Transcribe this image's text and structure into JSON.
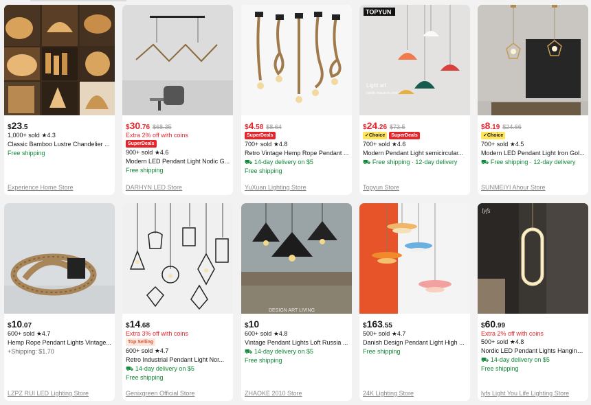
{
  "products": [
    {
      "currency": "$",
      "price_int": "23",
      "price_dec": ".5",
      "orig": "",
      "red": false,
      "extra": "",
      "badges": [],
      "sold": "1,000+ sold",
      "rating": "4.3",
      "title": "Classic Bamboo Lustre Chandelier ...",
      "ship1": "Free shipping",
      "ship2": "",
      "store": "Experience Home Store"
    },
    {
      "currency": "$",
      "price_int": "30",
      "price_dec": ".76",
      "orig": "$68.35",
      "red": true,
      "extra": "Extra 2% off with coins",
      "badges": [
        "SuperDeals"
      ],
      "sold": "900+ sold",
      "rating": "4.6",
      "title": "Modern LED Pendant Light Nodic G...",
      "ship1": "Free shipping",
      "ship2": "",
      "store": "DARHYN LED Store"
    },
    {
      "currency": "$",
      "price_int": "4",
      "price_dec": ".58",
      "orig": "$8.64",
      "red": true,
      "extra": "",
      "badges": [
        "SuperDeals"
      ],
      "sold": "700+ sold",
      "rating": "4.8",
      "title": "Retro Vintage Hemp Rope Pendant ...",
      "ship1": "14-day delivery on $5",
      "ship2": "Free shipping",
      "store": "YuXuan Lighting Store"
    },
    {
      "currency": "$",
      "price_int": "24",
      "price_dec": ".26",
      "orig": "$73.5",
      "red": true,
      "extra": "",
      "badges": [
        "Choice",
        "SuperDeals"
      ],
      "sold": "700+ sold",
      "rating": "4.6",
      "title": "Modern Pendant Light semicircular...",
      "ship1": "Free shipping · 12-day delivery",
      "ship2": "",
      "store": "Topyun Store"
    },
    {
      "currency": "$",
      "price_int": "8",
      "price_dec": ".19",
      "orig": "$24.66",
      "red": true,
      "extra": "",
      "badges": [
        "Choice"
      ],
      "sold": "700+ sold",
      "rating": "4.5",
      "title": "Modern LED Pendant Light Iron Gol...",
      "ship1": "Free shipping · 12-day delivery",
      "ship2": "",
      "store": "SUNMEIYI Ahour Store"
    },
    {
      "currency": "$",
      "price_int": "10",
      "price_dec": ".07",
      "orig": "",
      "red": false,
      "extra": "",
      "badges": [],
      "sold": "600+ sold",
      "rating": "4.7",
      "title": "Hemp Rope Pendant Lights Vintage...",
      "ship1": "",
      "ship2": "+Shipping: $1.70",
      "store": "LZPZ RUI LED Lighting Store"
    },
    {
      "currency": "$",
      "price_int": "14",
      "price_dec": ".68",
      "orig": "",
      "red": false,
      "extra": "Extra 3% off with coins",
      "badges": [
        "Top Selling"
      ],
      "sold": "600+ sold",
      "rating": "4.7",
      "title": "Retro Industrial Pendant Light Nor...",
      "ship1": "14-day delivery on $5",
      "ship2": "Free shipping",
      "store": "Genixgreen Official Store"
    },
    {
      "currency": "$",
      "price_int": "10",
      "price_dec": "",
      "orig": "",
      "red": false,
      "extra": "",
      "badges": [],
      "sold": "600+ sold",
      "rating": "4.8",
      "title": "Vintage Pendant Lights Loft Russia ...",
      "ship1": "14-day delivery on $5",
      "ship2": "Free shipping",
      "store": "ZHAOKE 2010 Store"
    },
    {
      "currency": "$",
      "price_int": "163",
      "price_dec": ".55",
      "orig": "",
      "red": false,
      "extra": "",
      "badges": [],
      "sold": "500+ sold",
      "rating": "4.7",
      "title": "Danish Design Pendant Light High ...",
      "ship1": "Free shipping",
      "ship2": "",
      "store": "24K Lighting Store"
    },
    {
      "currency": "$",
      "price_int": "60",
      "price_dec": ".99",
      "orig": "",
      "red": false,
      "extra": "Extra 2% off with coins",
      "badges": [],
      "sold": "500+ sold",
      "rating": "4.8",
      "title": "Nordic LED Pendant Lights Hanging...",
      "ship1": "14-day delivery on $5",
      "ship2": "Free shipping",
      "store": "lyfs Light You Life Lighting Store"
    }
  ],
  "image_text": {
    "topyun_logo": "TOPYUN",
    "topyun_caption": "Light art",
    "topyun_sub": "nordic macaron chandelier",
    "loft_caption": "DESIGN ART LIVING"
  },
  "colors": {
    "red": "#e5242b",
    "green": "#108a36",
    "choice": "#ffe45c"
  }
}
